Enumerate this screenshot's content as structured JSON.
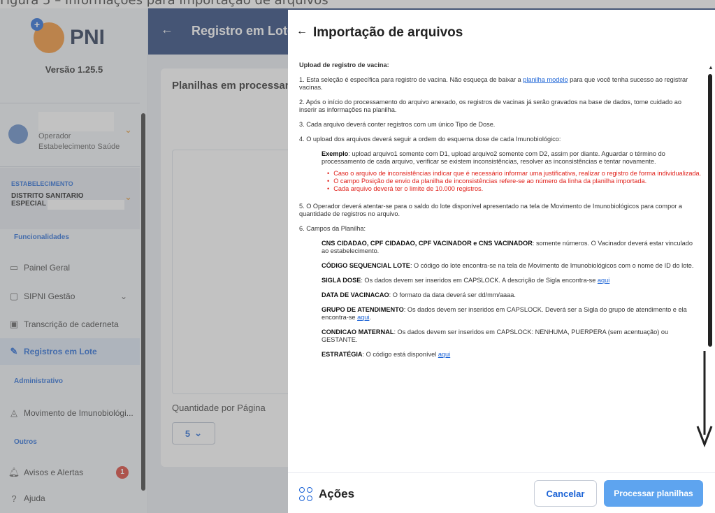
{
  "caption": "Figura 5 – Informações para importação de arquivos",
  "sidebar": {
    "logo_text": "PNI",
    "version": "Versão 1.25.5",
    "user_role_line1": "Operador",
    "user_role_line2": "Estabelecimento Saúde",
    "estab_label": "ESTABELECIMENTO",
    "estab_name": "DISTRITO SANITARIO ESPECIAL INDIGENA",
    "section_funcionalidades": "Funcionalidades",
    "nav_painel": "Painel Geral",
    "nav_sipni": "SIPNI Gestão",
    "nav_transcricao": "Transcrição de caderneta",
    "nav_registros": "Registros em Lote",
    "section_administrativo": "Administrativo",
    "nav_movimento": "Movimento de Imunobiológi...",
    "section_outros": "Outros",
    "nav_avisos": "Avisos e Alertas",
    "avisos_count": "1",
    "nav_ajuda": "Ajuda"
  },
  "topbar": {
    "title": "Registro em Lote"
  },
  "page": {
    "card_title": "Planilhas em processamento",
    "qty_label": "Quantidade por Página",
    "qty_value": "5"
  },
  "modal": {
    "title": "Importação de arquivos",
    "heading": "Upload de registro de vacina:",
    "p1_a": "1. Esta seleção é específica para registro de vacina. Não esqueça de baixar a ",
    "p1_link": "planilha modelo",
    "p1_b": " para que você tenha sucesso ao registrar vacinas.",
    "p2": "2. Após o início do processamento do arquivo anexado, os registros de vacinas já serão gravados na base de dados, tome cuidado ao inserir as informações na planilha.",
    "p3": "3. Cada arquivo deverá conter registros com um único Tipo de Dose.",
    "p4": "4. O upload dos arquivos deverá seguir a ordem do esquema dose de cada Imunobiológico:",
    "ex_label": "Exemplo",
    "ex_text": ": upload arquivo1 somente com D1, upload arquivo2 somente com D2, assim por diante. Aguardar o término do processamento de cada arquivo, verificar se existem inconsistências, resolver as inconsistências e tentar novamente.",
    "bullets": [
      "Caso o arquivo de inconsistências indicar que é necessário informar uma justificativa, realizar o registro de forma individualizada.",
      "O campo Posição de envio da planilha de inconsistências refere-se ao número da linha da planilha importada.",
      "Cada arquivo deverá ter o limite de 10.000 registros."
    ],
    "p5": "5. O Operador deverá atentar-se para o saldo do lote disponível apresentado na tela de Movimento de Imunobiológicos para compor a quantidade de registros no arquivo.",
    "p6": "6. Campos da Planilha:",
    "f1_label": "CNS CIDADAO, CPF CIDADAO, CPF VACINADOR e CNS VACINADOR",
    "f1_text": ": somente números. O Vacinador deverá estar vinculado ao estabelecimento.",
    "f2_label": "CÓDIGO SEQUENCIAL LOTE",
    "f2_text": ": O código do lote encontra-se na tela de Movimento de Imunobiológicos com o nome de ID do lote.",
    "f3_label": "SIGLA DOSE",
    "f3_text": ": Os dados devem ser inseridos em CAPSLOCK. A descrição de Sigla encontra-se ",
    "f3_link": "aqui",
    "f4_label": "DATA DE VACINACAO",
    "f4_text": ": O formato da data deverá ser dd/mm/aaaa.",
    "f5_label": "GRUPO DE ATENDIMENTO",
    "f5_text": ": Os dados devem ser inseridos em CAPSLOCK. Deverá ser a Sigla do grupo de atendimento e ela encontra-se ",
    "f5_link": "aqui",
    "f5_end": ".",
    "f6_label": "CONDICAO MATERNAL",
    "f6_text": ": Os dados devem ser inseridos em CAPSLOCK: NENHUMA, PUERPERA (sem acentuação) ou GESTANTE.",
    "f7_label": "ESTRATÉGIA",
    "f7_text": ": O código está disponível ",
    "f7_link": "aqui",
    "acoes": "Ações",
    "cancel": "Cancelar",
    "process": "Processar planilhas"
  },
  "colors": {
    "accent": "#1b63d6",
    "topbar": "#1d3a73",
    "warning_text": "#e0201a",
    "primary_button": "#5ea4ef"
  }
}
